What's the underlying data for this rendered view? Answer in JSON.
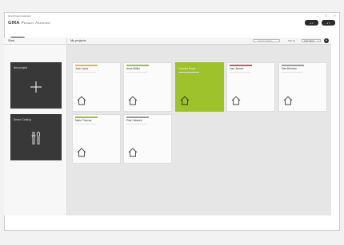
{
  "window": {
    "title": "Gira Project Assistant",
    "controls": [
      "–",
      "□",
      "×"
    ]
  },
  "brand": {
    "name": "GIRA",
    "product": "Project Assistant"
  },
  "top_buttons": [
    "● ▾",
    "● ▾"
  ],
  "back_button": "←",
  "left_panel": {
    "header": "Start",
    "tiles": [
      {
        "label": "New project",
        "icon": "plus-icon"
      },
      {
        "label": "Device Catalog",
        "icon": "tools-icon"
      }
    ]
  },
  "main": {
    "header": "My projects",
    "search_placeholder": "Search projects",
    "sort_label": "Sort by",
    "sort_value": "Last saved",
    "add_icon": "+",
    "projects": [
      {
        "name": "Jose Lopez",
        "bar": "#e0b84a",
        "selected": false
      },
      {
        "name": "Anna Müller",
        "bar": "#9dc22b",
        "selected": false
      },
      {
        "name": "Caterina Rossi",
        "bar": "#9dc22b",
        "selected": true
      },
      {
        "name": "Lars Jensen",
        "bar": "#d9534f",
        "selected": false
      },
      {
        "name": "Max Brennan",
        "bar": "#9a9a9a",
        "selected": false
      },
      {
        "name": "Marie Thomas",
        "bar": "#9dc22b",
        "selected": false
      },
      {
        "name": "Piotr Urbanek",
        "bar": "#9a9a9a",
        "selected": false
      }
    ]
  },
  "colors": {
    "accent": "#9dc22b",
    "dark": "#383838",
    "background": "#e6e6e6"
  }
}
